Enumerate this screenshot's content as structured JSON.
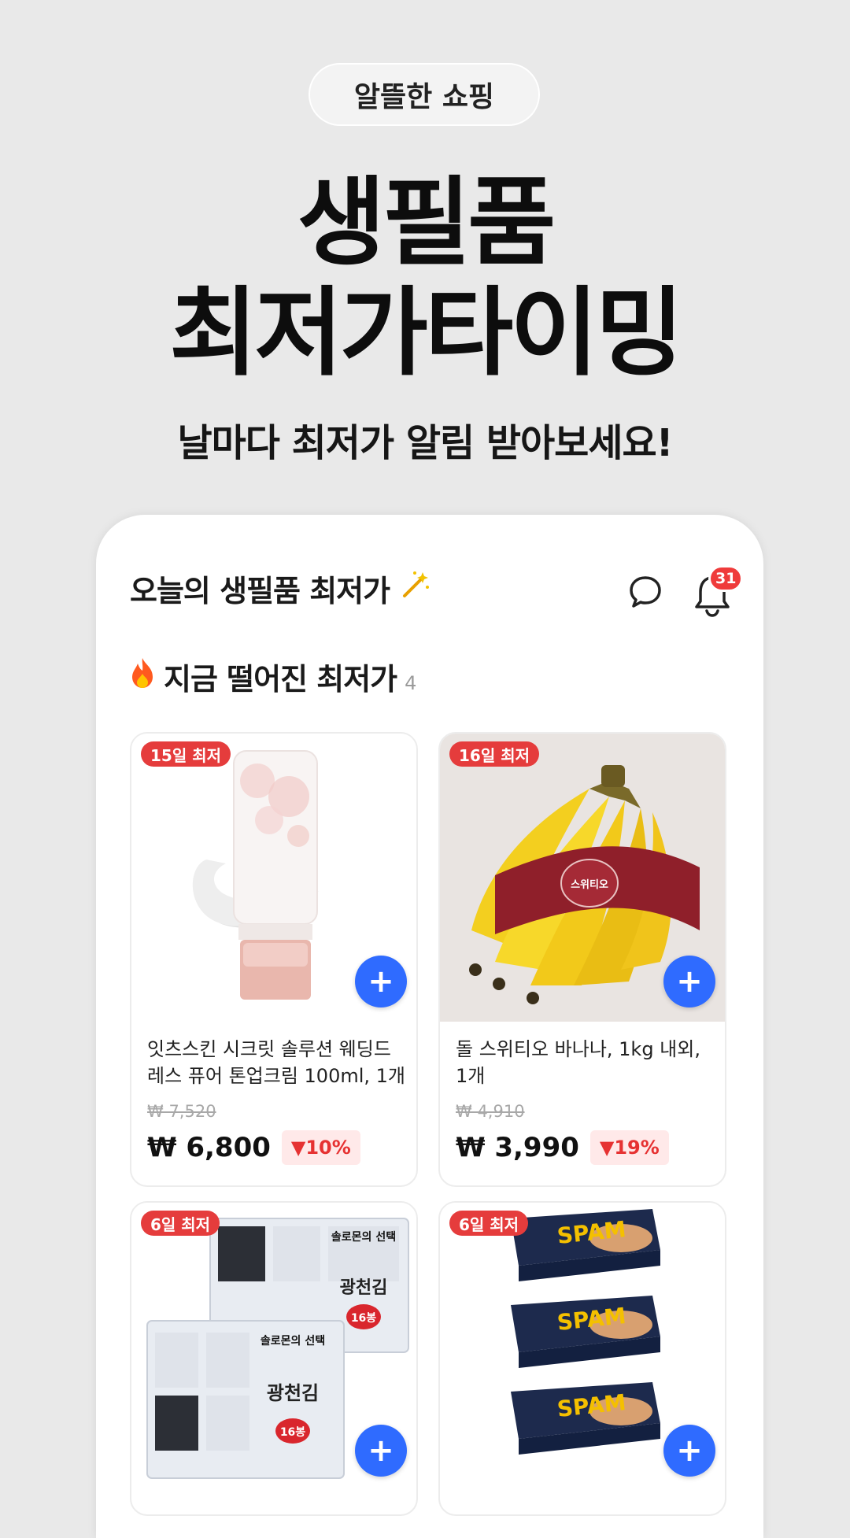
{
  "promo": {
    "pill": "알뜰한 쇼핑",
    "headline_line1": "생필품",
    "headline_line2": "최저가타이밍",
    "subtitle": "날마다 최저가 알림 받아보세요!"
  },
  "app": {
    "title": "오늘의 생필품 최저가",
    "title_icon": "magic-wand-icon",
    "notification_count": "31",
    "section_title": "지금 떨어진 최저가",
    "section_count": "4",
    "section_icon": "fire-icon"
  },
  "products": [
    {
      "tag": "15일 최저",
      "name": "잇츠스킨 시크릿 솔루션 웨딩드레스 퓨어 톤업크림 100ml, 1개",
      "original_price": "₩ 7,520",
      "price": "₩ 6,800",
      "discount": "▼10%",
      "image": "cream-tube"
    },
    {
      "tag": "16일 최저",
      "name": "돌 스위티오 바나나, 1kg 내외, 1개",
      "original_price": "₩ 4,910",
      "price": "₩ 3,990",
      "discount": "▼19%",
      "image": "banana-bunch",
      "image_label": "스위티오"
    },
    {
      "tag": "6일 최저",
      "image": "seaweed-packs",
      "image_labels": [
        "솔로몬의 선택",
        "광천김",
        "16봉"
      ]
    },
    {
      "tag": "6일 최저",
      "image": "spam-cans",
      "image_label": "SPAM"
    }
  ],
  "colors": {
    "accent_blue": "#2f6bff",
    "tag_red": "#e53c3c",
    "discount_red": "#e63232",
    "background": "#e9e9e9"
  }
}
